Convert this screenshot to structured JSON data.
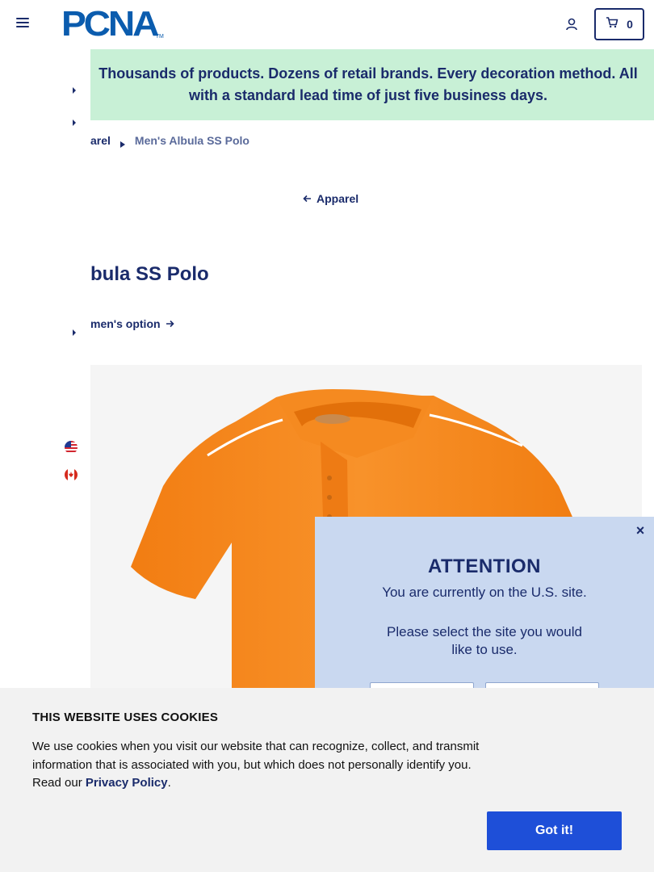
{
  "header": {
    "logo_text": "PCNA",
    "logo_tm": "TM",
    "cart_count": "0"
  },
  "promo": {
    "text": "Thousands of products. Dozens of retail brands. Every decoration method. All with a standard lead time of just five business days."
  },
  "breadcrumb": {
    "parent": "arel",
    "current": "Men's Albula SS Polo"
  },
  "back_link": {
    "label": "Apparel"
  },
  "product": {
    "title": "bula SS Polo",
    "alt_option": "men's option",
    "image_color": "#f68b1f"
  },
  "attention": {
    "close": "×",
    "title": "ATTENTION",
    "line1": "You are currently on the U.S. site.",
    "line2": "Please select the site you would like to use."
  },
  "cookie": {
    "title": "THIS WEBSITE USES COOKIES",
    "text_before": "We use cookies when you visit our website that can recognize, collect, and transmit information that is associated with you, but which does not personally identify you. Read our ",
    "link": "Privacy Policy",
    "text_after": ".",
    "button": "Got it!"
  },
  "colors": {
    "navy": "#1a2b6b",
    "logo_blue": "#0b5cae",
    "promo_bg": "#c8f0d6",
    "modal_bg": "#c9d8f0",
    "cookie_button": "#1e4fd8"
  },
  "icons": [
    "hamburger-icon",
    "account-icon",
    "cart-icon",
    "chevron-right-icon",
    "arrow-left-icon",
    "arrow-right-icon",
    "us-flag-icon",
    "canada-flag-icon",
    "close-icon"
  ]
}
